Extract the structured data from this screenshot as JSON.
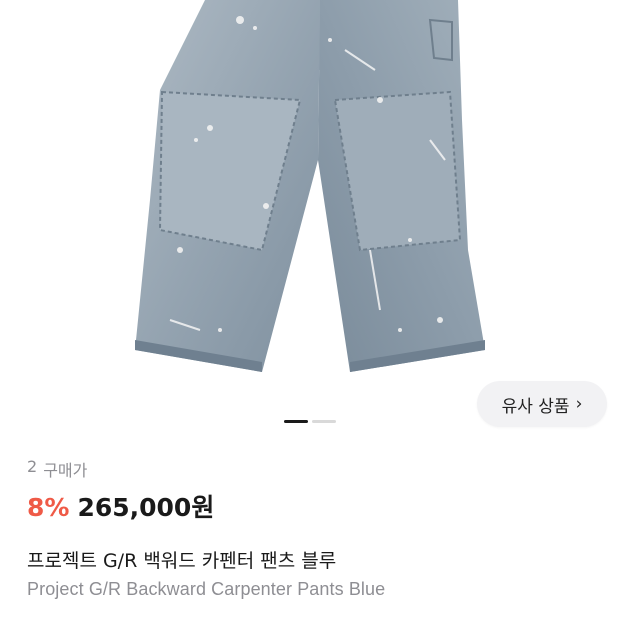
{
  "similar": {
    "label": "유사 상품",
    "chevron": "›"
  },
  "carousel": {
    "count": 2,
    "active": 0
  },
  "buyers": {
    "count": "2",
    "label": "구매가"
  },
  "price": {
    "discount": "8%",
    "amount": "265,000원"
  },
  "product": {
    "title_ko": "프로젝트 G/R 백워드 카펜터 팬츠 블루",
    "title_en": "Project G/R Backward Carpenter Pants Blue"
  },
  "colors": {
    "discount": "#ef5a47",
    "denim": "#8a9aa8"
  }
}
